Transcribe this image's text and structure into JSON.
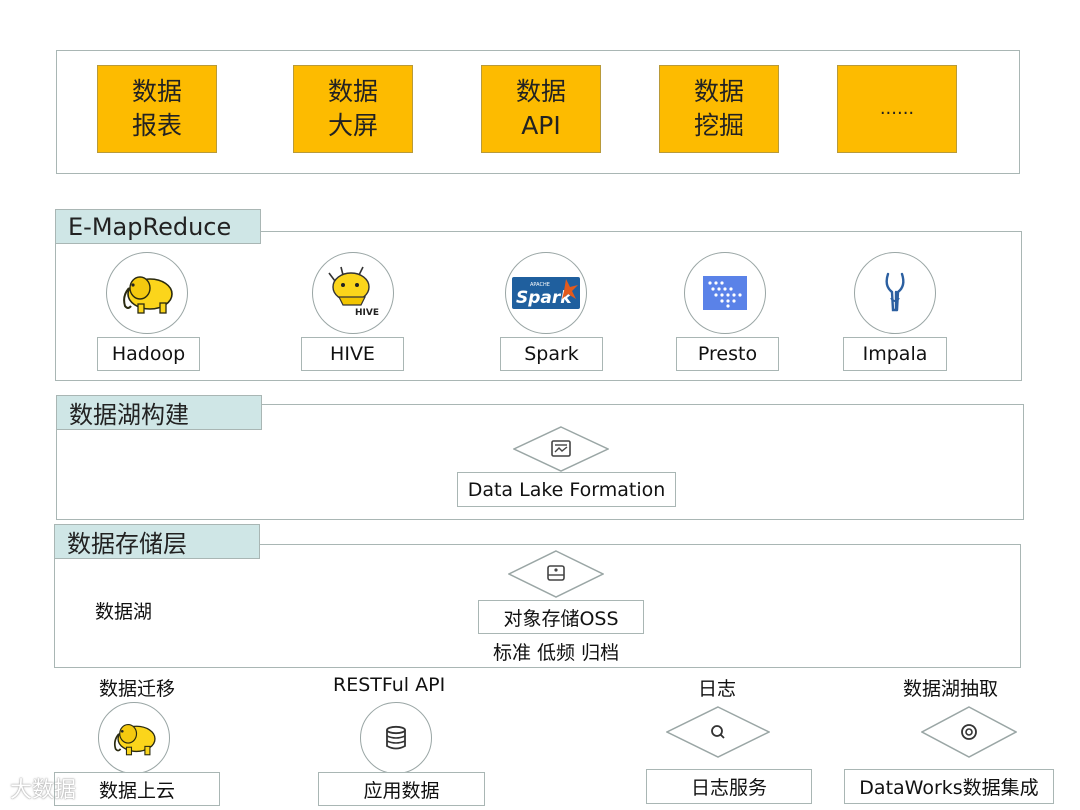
{
  "apps": {
    "items": [
      {
        "label": "数据\n报表"
      },
      {
        "label": "数据\n大屏"
      },
      {
        "label": "数据\nAPI"
      },
      {
        "label": "数据\n挖掘"
      },
      {
        "label": "......"
      }
    ]
  },
  "emr": {
    "title": "E-MapReduce",
    "engines": [
      {
        "label": "Hadoop",
        "icon": "hadoop-elephant-icon",
        "caption": ""
      },
      {
        "label": "HIVE",
        "icon": "hive-icon",
        "caption": "HIVE"
      },
      {
        "label": "Spark",
        "icon": "spark-icon",
        "caption": "Spark",
        "caption_small": "APACHE"
      },
      {
        "label": "Presto",
        "icon": "presto-icon",
        "caption": ""
      },
      {
        "label": "Impala",
        "icon": "impala-icon",
        "caption": ""
      }
    ]
  },
  "lake_build": {
    "title": "数据湖构建",
    "service": "Data Lake Formation",
    "icon": "chart-frame-icon"
  },
  "storage": {
    "title": "数据存储层",
    "side_label": "数据湖",
    "service": "对象存储OSS",
    "tiers": "标准 低频 归档",
    "icon": "storage-drive-icon"
  },
  "sources": [
    {
      "top": "数据迁移",
      "bottom": "数据上云",
      "icon": "hadoop-elephant-icon"
    },
    {
      "top": "RESTFul API",
      "bottom": "应用数据",
      "icon": "database-icon"
    },
    {
      "top": "日志",
      "bottom": "日志服务",
      "icon": "search-icon"
    },
    {
      "top": "数据湖抽取",
      "bottom": "DataWorks数据集成",
      "icon": "target-icon"
    }
  ],
  "watermark": "大数据",
  "colors": {
    "app_fill": "#fdbb00",
    "tag_fill": "#cfe6e6",
    "border": "#a9b6b4",
    "presto_blue": "#5a82e8",
    "impala_blue": "#2b5fa0"
  }
}
